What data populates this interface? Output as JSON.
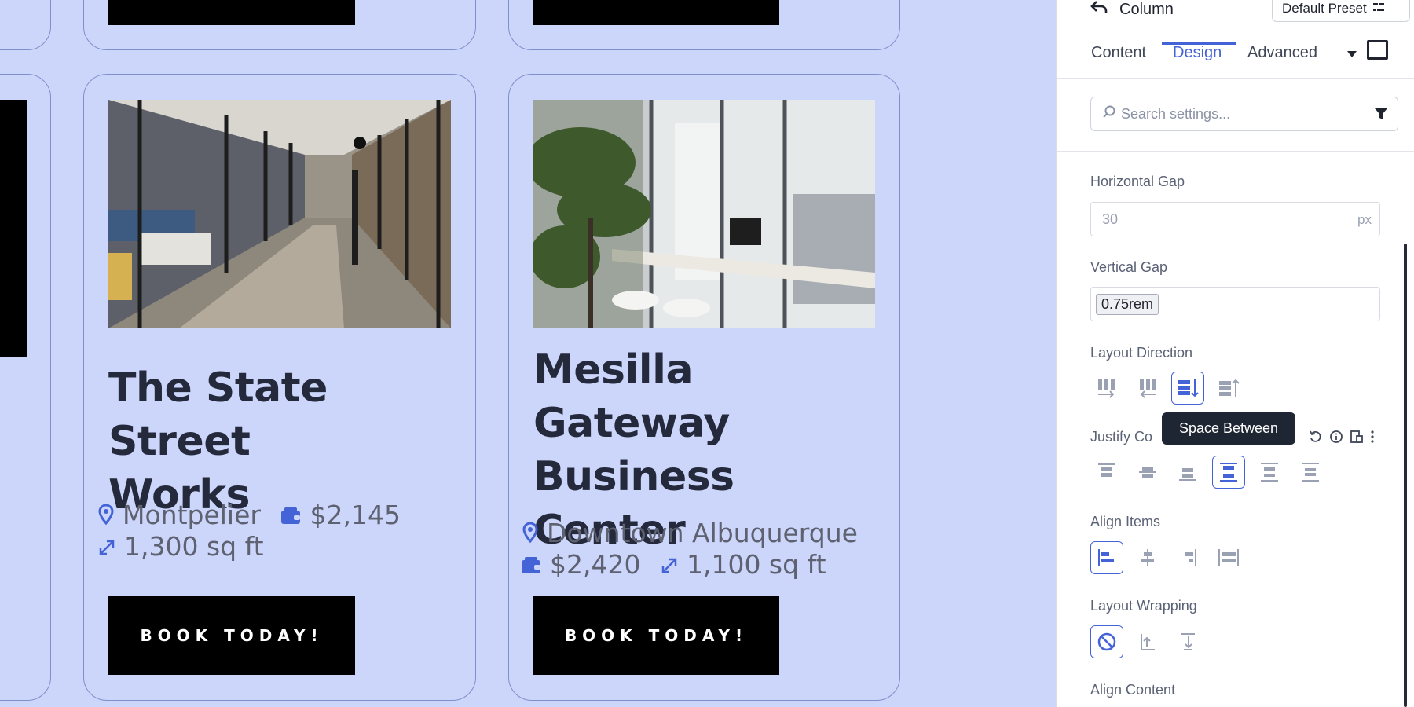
{
  "cards": [
    {
      "title_lines": [
        "The State Street",
        "Works"
      ],
      "location": "Montpelier",
      "price": "$2,145",
      "size": "1,300 sq ft",
      "button": "BOOK TODAY!"
    },
    {
      "title_lines": [
        "Mesilla",
        "Gateway",
        "Business Center"
      ],
      "location": "Downtown Albuquerque",
      "price": "$2,420",
      "size": "1,100 sq ft",
      "button": "BOOK TODAY!"
    }
  ],
  "panel": {
    "title": "Column",
    "preset": "Default Preset",
    "tabs": [
      "Content",
      "Design",
      "Advanced"
    ],
    "active_tab": "Design",
    "search_placeholder": "Search settings...",
    "horizontal_gap": {
      "label": "Horizontal Gap",
      "placeholder": "30",
      "unit": "px"
    },
    "vertical_gap": {
      "label": "Vertical Gap",
      "value": "0.75rem"
    },
    "layout_direction": {
      "label": "Layout Direction"
    },
    "justify_content": {
      "label": "Justify Co"
    },
    "tooltip": "Space Between",
    "align_items": {
      "label": "Align Items"
    },
    "layout_wrapping": {
      "label": "Layout Wrapping"
    },
    "align_content": {
      "label": "Align Content"
    }
  },
  "colors": {
    "accent": "#4463d6",
    "canvas_bg": "#ccd6fb",
    "title_text": "#242a3b",
    "button_bg": "#000000"
  }
}
